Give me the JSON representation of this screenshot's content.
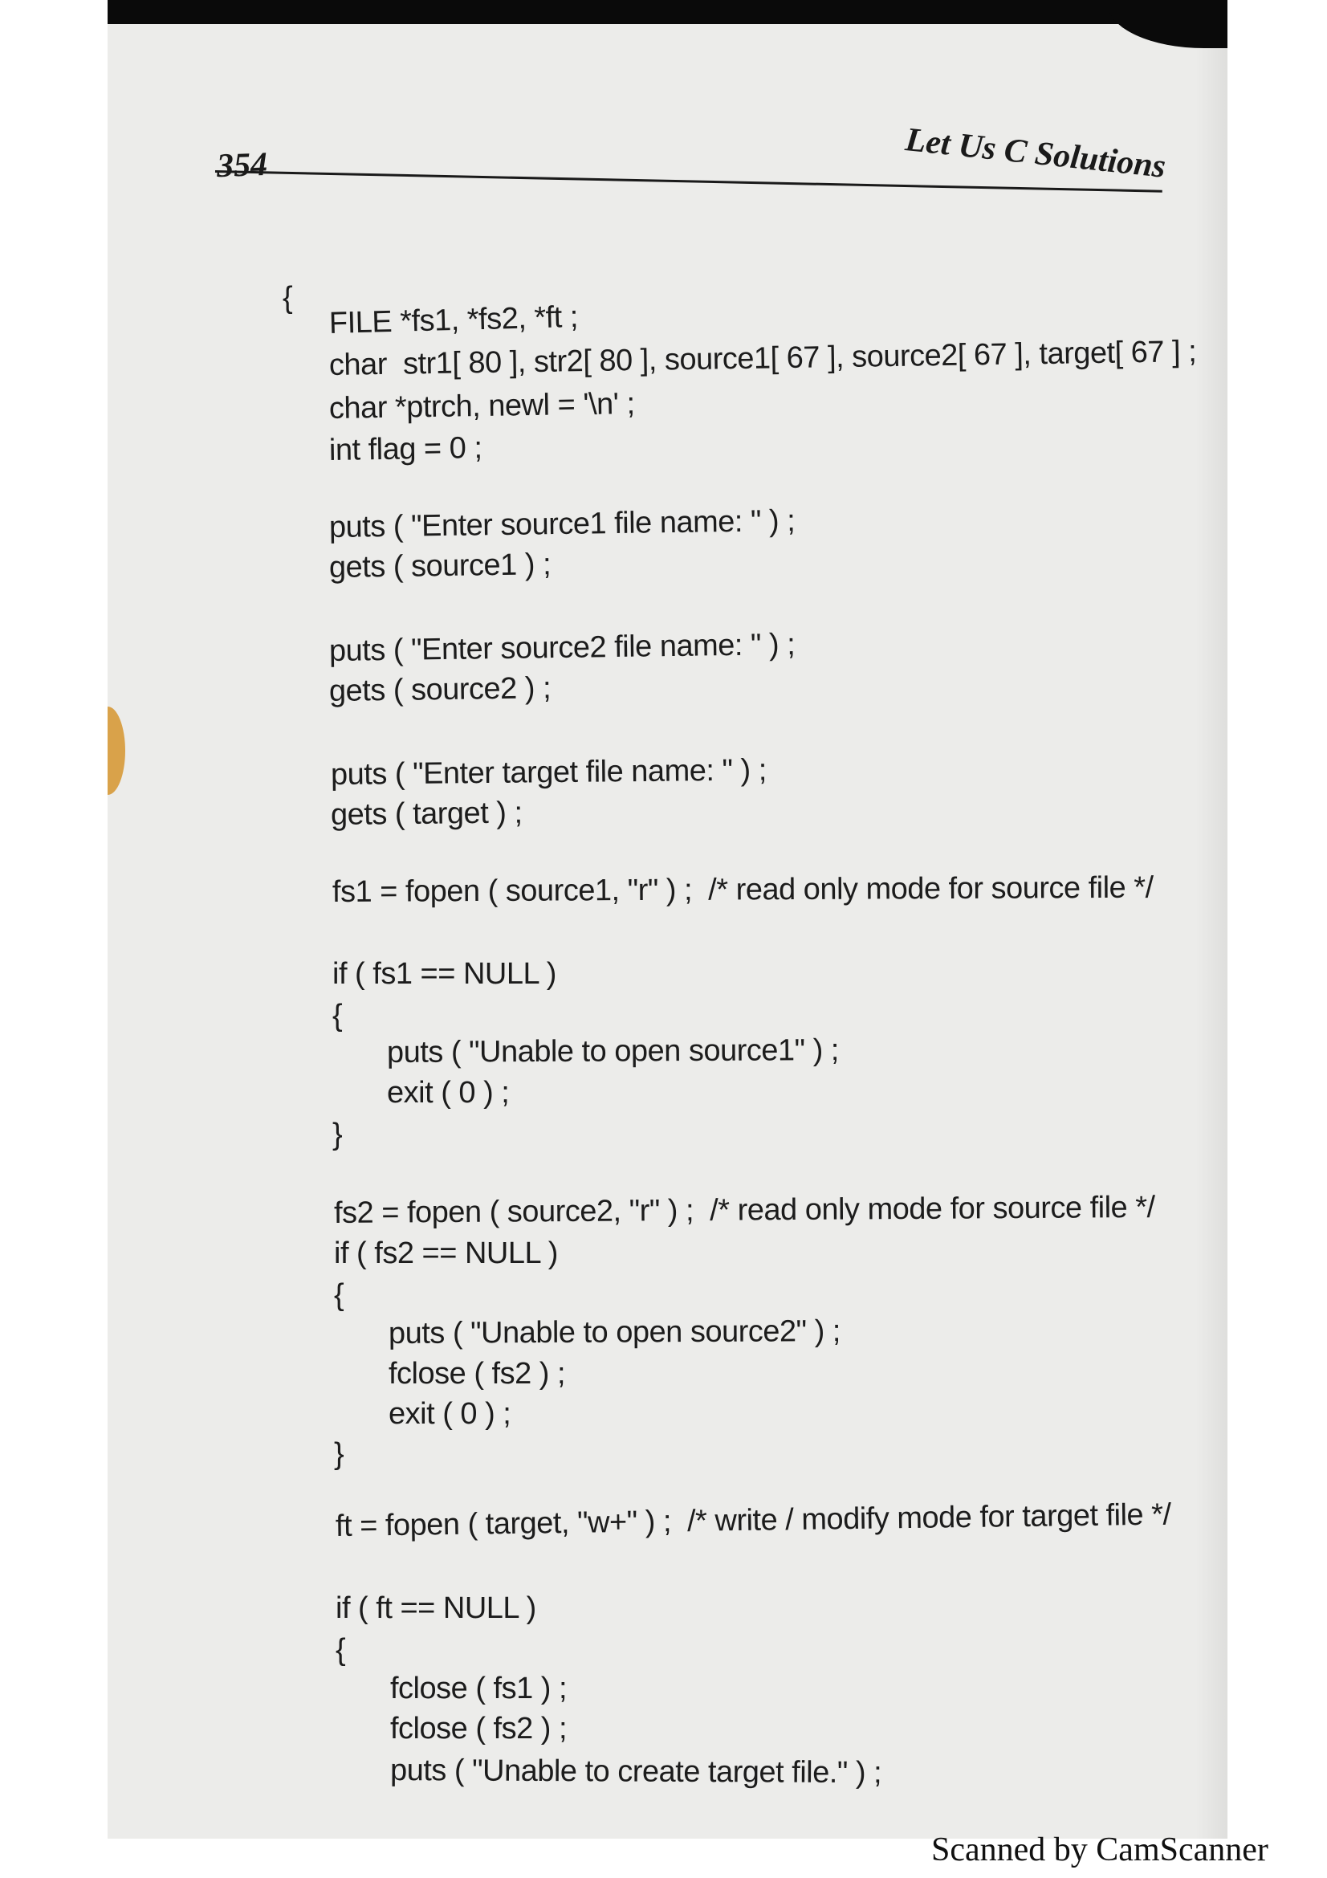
{
  "header": {
    "page_number": "354",
    "running_title": "Let Us C Solutions"
  },
  "code_lines": [
    "{",
    "FILE *fs1, *fs2, *ft ;",
    "char  str1[ 80 ], str2[ 80 ], source1[ 67 ], source2[ 67 ], target[ 67 ] ;",
    "char *ptrch, newl = '\\n' ;",
    "int flag = 0 ;",
    "puts ( \"Enter source1 file name: \" ) ;",
    "gets ( source1 ) ;",
    "puts ( \"Enter source2 file name: \" ) ;",
    "gets ( source2 ) ;",
    "puts ( \"Enter target file name: \" ) ;",
    "gets ( target ) ;",
    "fs1 = fopen ( source1, \"r\" ) ;  /* read only mode for source file */",
    "if ( fs1 == NULL )",
    "{",
    "puts ( \"Unable to open source1\" ) ;",
    "exit ( 0 ) ;",
    "}",
    "fs2 = fopen ( source2, \"r\" ) ;  /* read only mode for source file */",
    "if ( fs2 == NULL )",
    "{",
    "puts ( \"Unable to open source2\" ) ;",
    "fclose ( fs2 ) ;",
    "exit ( 0 ) ;",
    "}",
    "ft = fopen ( target, \"w+\" ) ;  /* write / modify mode for target file */",
    "if ( ft == NULL )",
    "{",
    "fclose ( fs1 ) ;",
    "fclose ( fs2 ) ;",
    "puts ( \"Unable to create target file.\" ) ;"
  ],
  "footer": {
    "scanner_stamp": "Scanned by CamScanner"
  }
}
